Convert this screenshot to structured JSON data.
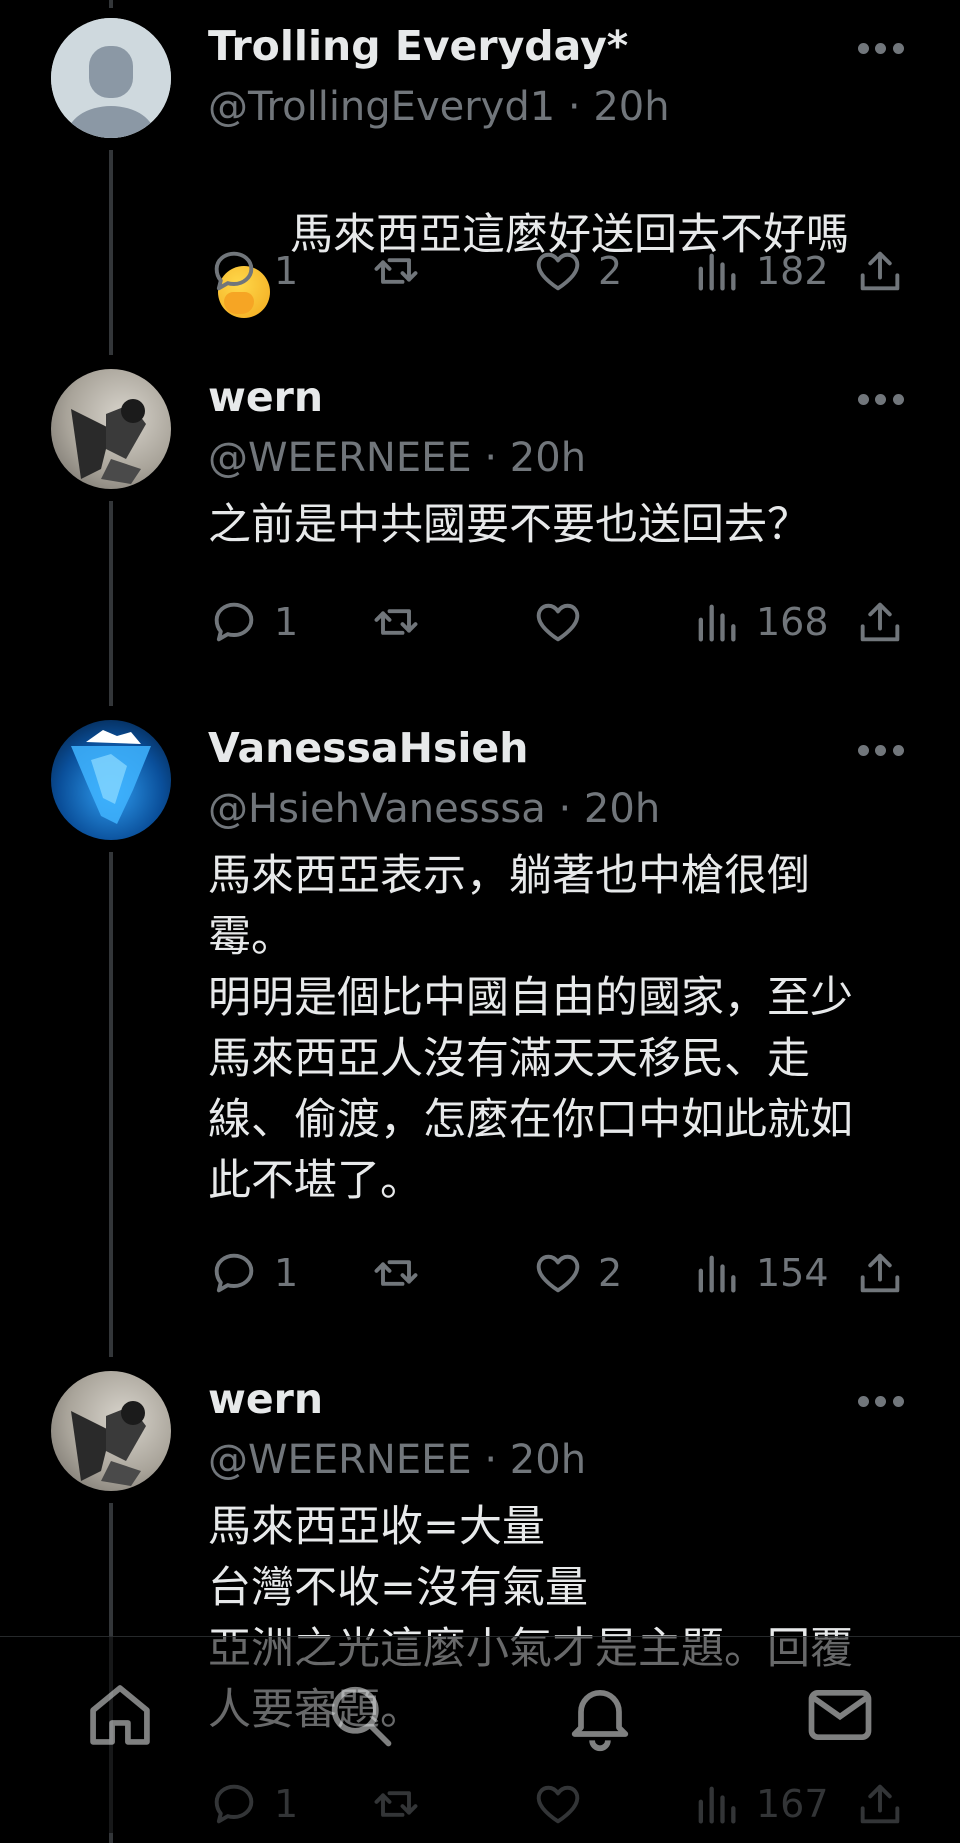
{
  "tweets": [
    {
      "name": "Trolling Everyday*",
      "handle": "@TrollingEveryd1",
      "time": "20h",
      "text": "馬來西亞這麼好送回去不好嗎",
      "emoji": "hand-over-mouth-emoji",
      "replies": "1",
      "retweets": "",
      "likes": "2",
      "views": "182"
    },
    {
      "name": "wern",
      "handle": "@WEERNEEE",
      "time": "20h",
      "text": "之前是中共國要不要也送回去？",
      "replies": "1",
      "retweets": "",
      "likes": "",
      "views": "168"
    },
    {
      "name": "VanessaHsieh",
      "handle": "@HsiehVanesssa",
      "time": "20h",
      "text": "馬來西亞表示，躺著也中槍很倒\n霉。\n明明是個比中國自由的國家，至少\n馬來西亞人沒有滿天天移民、走\n線、偷渡，怎麼在你口中如此就如\n此不堪了。",
      "replies": "1",
      "retweets": "",
      "likes": "2",
      "views": "154"
    },
    {
      "name": "wern",
      "handle": "@WEERNEEE",
      "time": "20h",
      "text": "馬來西亞收=大量\n台灣不收=沒有氣量\n亞洲之光這麼小氣才是主題。回覆\n人要審題。",
      "replies": "1",
      "retweets": "",
      "likes": "",
      "views": "167"
    }
  ],
  "meta_separator": " · ",
  "colors": {
    "background": "#000000",
    "text": "#e7e9ea",
    "secondary": "#71767b",
    "thread_line": "#333639"
  },
  "bottom_nav": [
    "home-icon",
    "search-icon",
    "notifications-icon",
    "messages-icon"
  ]
}
